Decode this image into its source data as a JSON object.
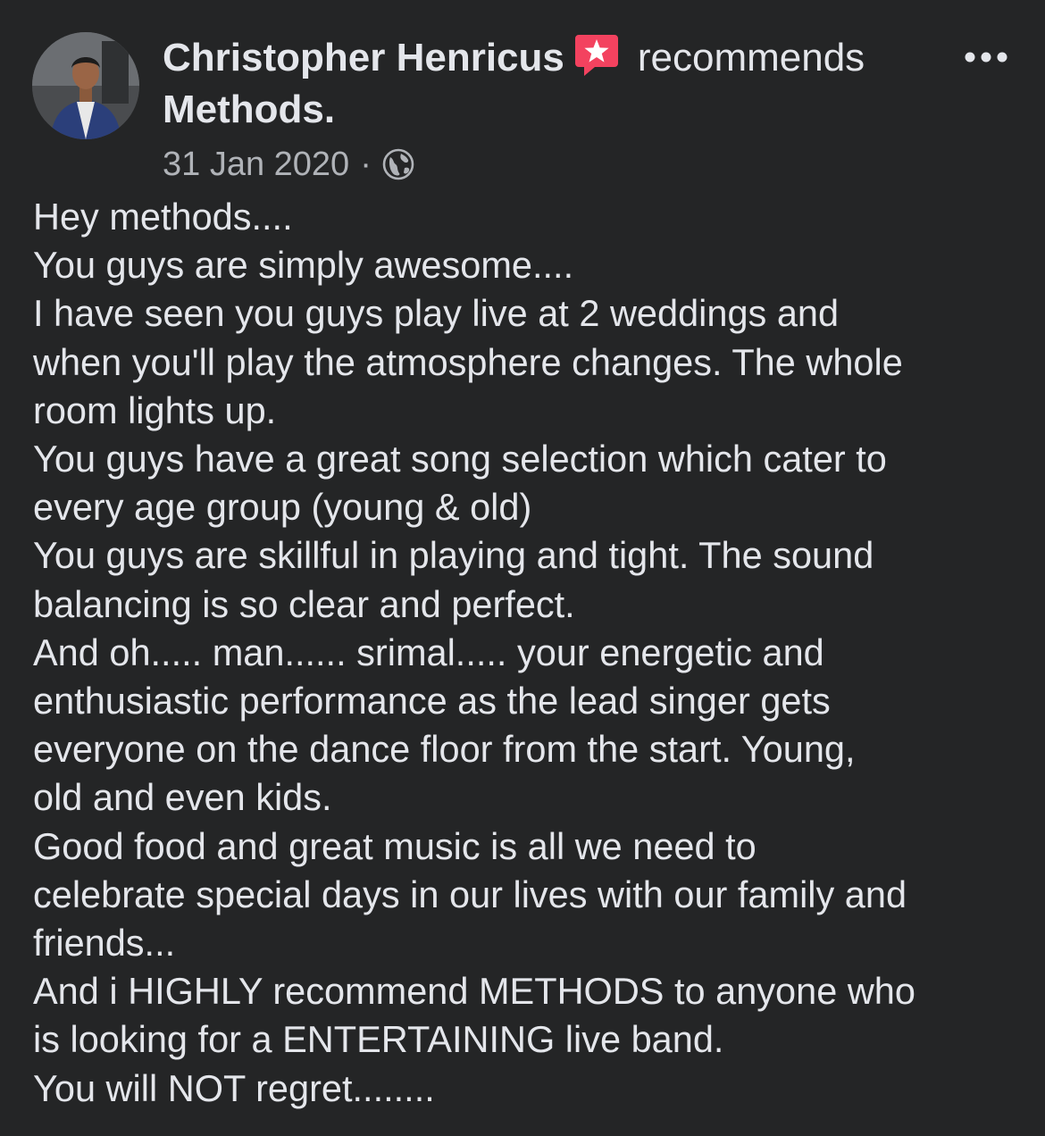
{
  "post": {
    "author": "Christopher Henricus",
    "verb": "recommends",
    "page_name": "Methods.",
    "date": "31 Jan 2020",
    "separator": "·",
    "badge_icon": "recommendation-star-icon",
    "privacy_icon": "globe-icon",
    "more_icon": "more-options-icon",
    "body_lines": [
      "Hey methods....",
      "You guys are simply awesome....",
      "I have seen you guys play live at 2 weddings and",
      "when you'll play the atmosphere changes. The whole",
      "room lights up.",
      "You guys have a great song selection which cater to",
      "every age group (young & old)",
      "You guys are skillful in playing and tight. The sound",
      "balancing is so clear and perfect.",
      "And oh..... man...... srimal..... your energetic and",
      "enthusiastic performance as the lead singer gets",
      "everyone on the dance floor from the start. Young,",
      "old and even kids.",
      "Good food and great music is all we need to",
      "celebrate special days in our lives with our family and",
      "friends...",
      "And i HIGHLY recommend METHODS to anyone who",
      "is looking for a ENTERTAINING live band.",
      "You will NOT regret........"
    ]
  },
  "colors": {
    "background": "#242526",
    "text_primary": "#e4e6eb",
    "text_secondary": "#b0b3b8",
    "badge": "#f3425f"
  }
}
